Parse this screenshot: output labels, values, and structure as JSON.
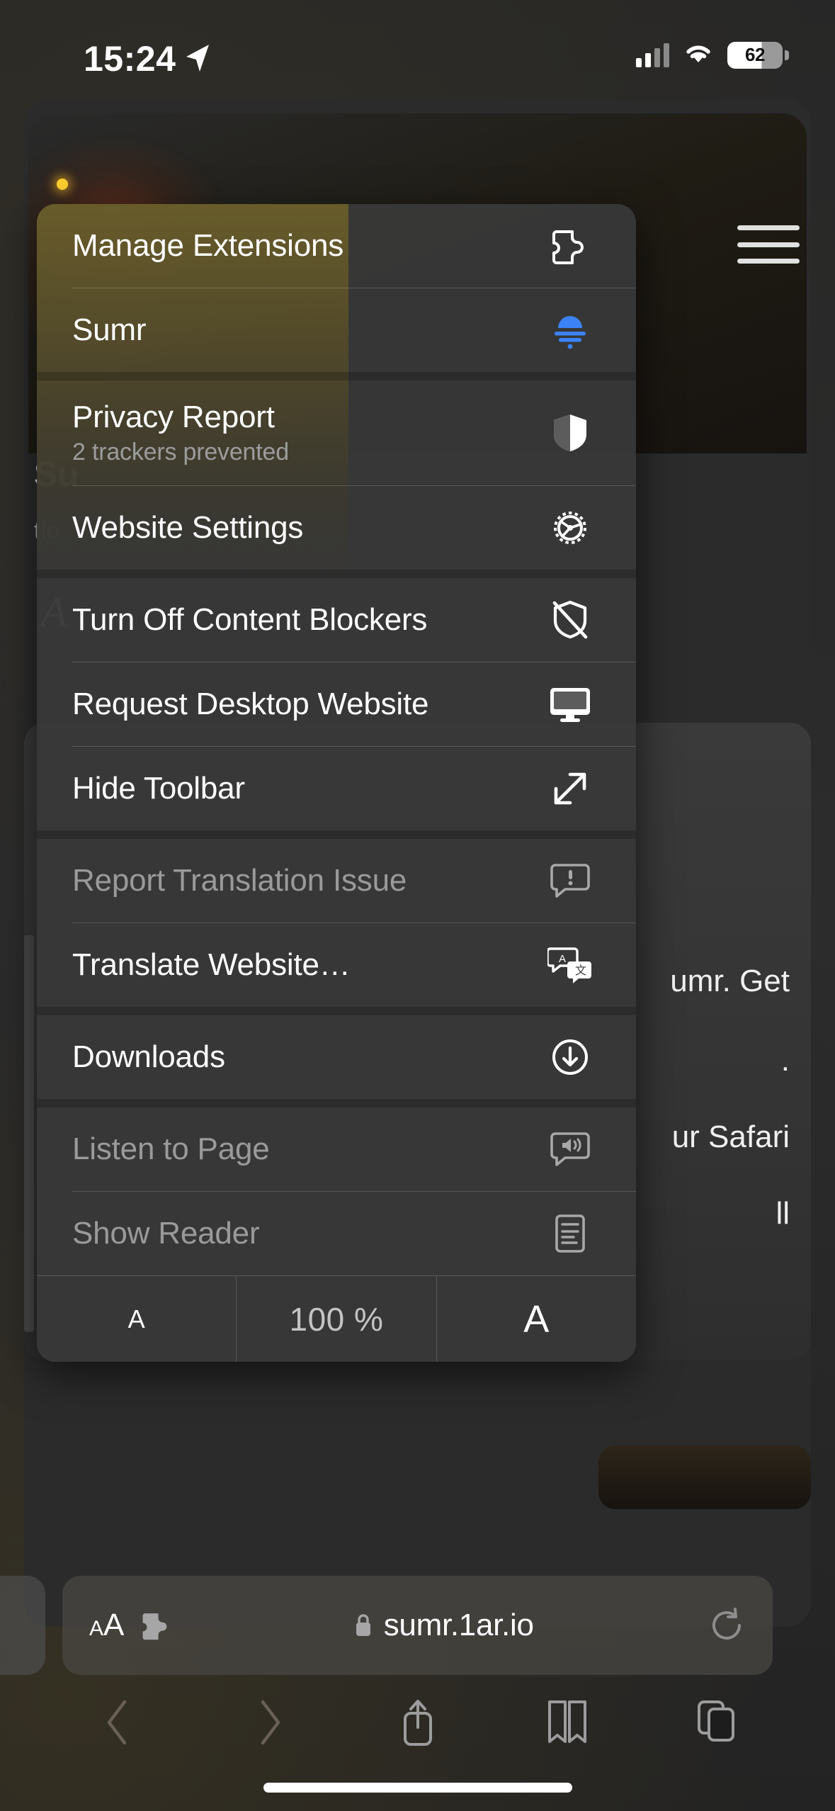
{
  "status_bar": {
    "time": "15:24",
    "location_icon": "location-arrow-icon",
    "signal_icon": "cellular-signal-icon",
    "wifi_icon": "wifi-icon",
    "battery_level": "62"
  },
  "background_page": {
    "title_fragment": "Su",
    "subtitle_fragment": "tlo",
    "script_fragment": "A",
    "menu_icon": "hamburger-menu-icon",
    "card_lines": [
      "umr. Get",
      ".",
      "ur Safari",
      "ll"
    ]
  },
  "menu": {
    "items": [
      {
        "label": "Manage Extensions",
        "icon": "puzzle-piece-icon",
        "enabled": true
      },
      {
        "label": "Sumr",
        "icon": "sumr-extension-icon",
        "enabled": true
      },
      {
        "label": "Privacy Report",
        "sublabel": "2 trackers prevented",
        "icon": "shield-icon",
        "enabled": true
      },
      {
        "label": "Website Settings",
        "icon": "gear-icon",
        "enabled": true
      },
      {
        "label": "Turn Off Content Blockers",
        "icon": "shield-slash-icon",
        "enabled": true
      },
      {
        "label": "Request Desktop Website",
        "icon": "desktop-monitor-icon",
        "enabled": true
      },
      {
        "label": "Hide Toolbar",
        "icon": "arrows-diagonal-icon",
        "enabled": true
      },
      {
        "label": "Report Translation Issue",
        "icon": "bubble-exclamation-icon",
        "enabled": false
      },
      {
        "label": "Translate Website…",
        "icon": "translate-bubbles-icon",
        "enabled": true
      },
      {
        "label": "Downloads",
        "icon": "download-circle-icon",
        "enabled": true
      },
      {
        "label": "Listen to Page",
        "icon": "bubble-speaker-icon",
        "enabled": false
      },
      {
        "label": "Show Reader",
        "icon": "reader-document-icon",
        "enabled": false
      }
    ],
    "zoom_row": {
      "decrease_label": "A",
      "value": "100 %",
      "increase_label": "A"
    }
  },
  "url_bar": {
    "text_size_label_small": "A",
    "text_size_label_large": "A",
    "extensions_icon": "puzzle-piece-icon",
    "lock_icon": "lock-icon",
    "url": "sumr.1ar.io",
    "reload_icon": "reload-icon"
  },
  "toolbar": {
    "buttons": [
      {
        "name": "back-button",
        "icon": "chevron-left-icon",
        "enabled": false
      },
      {
        "name": "forward-button",
        "icon": "chevron-right-icon",
        "enabled": false
      },
      {
        "name": "share-button",
        "icon": "share-icon",
        "enabled": true
      },
      {
        "name": "bookmarks-button",
        "icon": "book-icon",
        "enabled": true
      },
      {
        "name": "tabs-button",
        "icon": "tabs-icon",
        "enabled": true
      }
    ]
  },
  "colors": {
    "accent_blue": "#3b82f6",
    "menu_background": "#383838",
    "page_background": "#2b2b2b",
    "disabled_text": "#9a9a9a"
  }
}
